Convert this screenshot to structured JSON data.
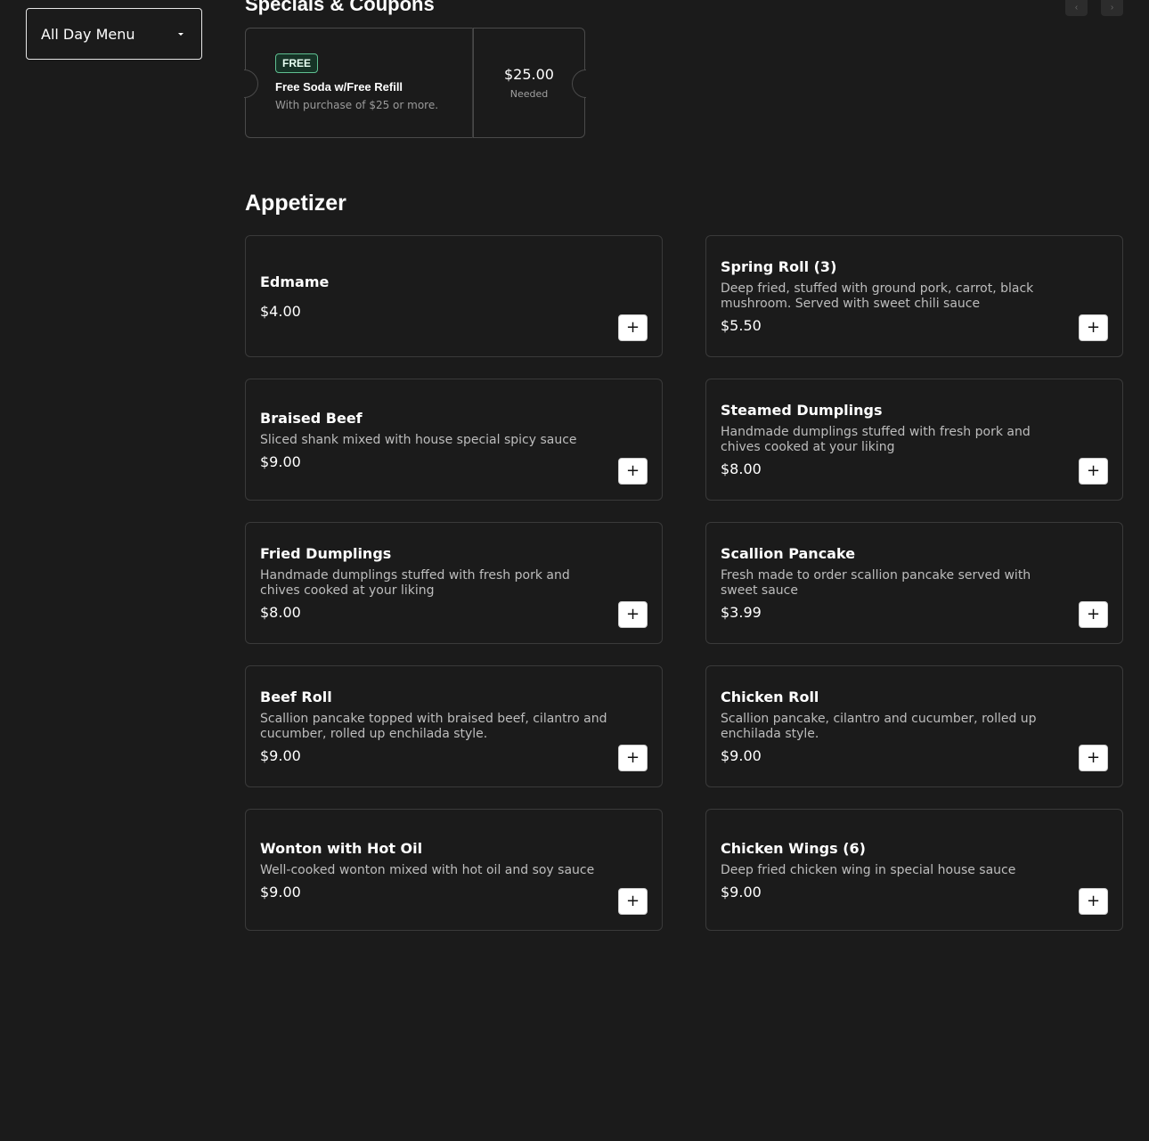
{
  "menu_select": {
    "value": "All Day Menu"
  },
  "specials": {
    "title": "Specials & Coupons",
    "coupon": {
      "badge": "FREE",
      "title": "Free Soda w/Free Refill",
      "description": "With purchase of $25 or more.",
      "amount": "$25.00",
      "amount_label": "Needed"
    }
  },
  "appetizer": {
    "title": "Appetizer",
    "items": [
      {
        "name": "Edmame",
        "description": "",
        "price": "$4.00"
      },
      {
        "name": "Spring Roll (3)",
        "description": "Deep fried, stuffed with ground pork, carrot, black mushroom. Served with sweet chili sauce",
        "price": "$5.50"
      },
      {
        "name": "Braised Beef",
        "description": "Sliced shank mixed with house special spicy sauce",
        "price": "$9.00"
      },
      {
        "name": "Steamed Dumplings",
        "description": "Handmade dumplings stuffed with fresh pork and chives cooked at your liking",
        "price": "$8.00"
      },
      {
        "name": "Fried Dumplings",
        "description": "Handmade dumplings stuffed with fresh pork and chives cooked at your liking",
        "price": "$8.00"
      },
      {
        "name": "Scallion Pancake",
        "description": "Fresh made to order scallion pancake served with sweet sauce",
        "price": "$3.99"
      },
      {
        "name": "Beef Roll",
        "description": "Scallion pancake topped with braised beef, cilantro and cucumber, rolled up enchilada style.",
        "price": "$9.00"
      },
      {
        "name": "Chicken Roll",
        "description": "Scallion pancake, cilantro and cucumber, rolled up enchilada style.",
        "price": "$9.00"
      },
      {
        "name": "Wonton with Hot Oil",
        "description": "Well-cooked wonton mixed with hot oil and soy sauce",
        "price": "$9.00"
      },
      {
        "name": "Chicken Wings (6)",
        "description": "Deep fried chicken wing in special house sauce",
        "price": "$9.00"
      }
    ],
    "add_label": "+"
  },
  "colors": {
    "background": "#1b1b1b",
    "badge_border": "#5fbf91",
    "card_border": "#3a3a3a"
  }
}
